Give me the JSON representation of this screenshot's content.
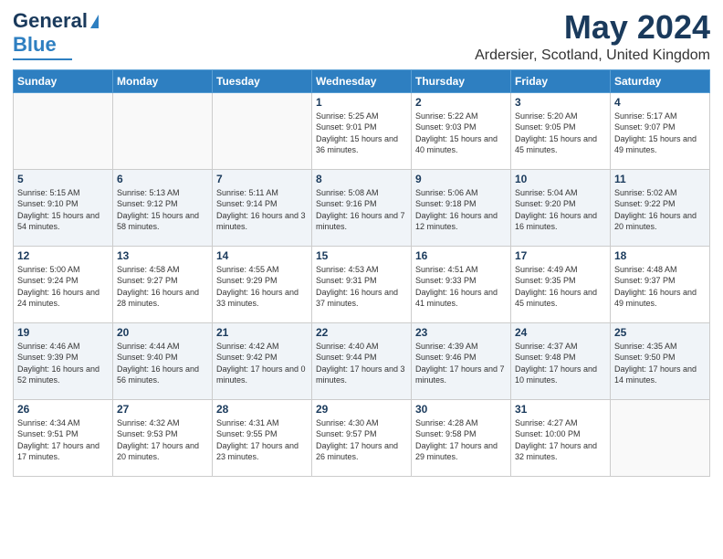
{
  "logo": {
    "line1": "General",
    "line2": "Blue"
  },
  "title": "May 2024",
  "subtitle": "Ardersier, Scotland, United Kingdom",
  "headers": [
    "Sunday",
    "Monday",
    "Tuesday",
    "Wednesday",
    "Thursday",
    "Friday",
    "Saturday"
  ],
  "weeks": [
    [
      {
        "day": "",
        "info": ""
      },
      {
        "day": "",
        "info": ""
      },
      {
        "day": "",
        "info": ""
      },
      {
        "day": "1",
        "info": "Sunrise: 5:25 AM\nSunset: 9:01 PM\nDaylight: 15 hours\nand 36 minutes."
      },
      {
        "day": "2",
        "info": "Sunrise: 5:22 AM\nSunset: 9:03 PM\nDaylight: 15 hours\nand 40 minutes."
      },
      {
        "day": "3",
        "info": "Sunrise: 5:20 AM\nSunset: 9:05 PM\nDaylight: 15 hours\nand 45 minutes."
      },
      {
        "day": "4",
        "info": "Sunrise: 5:17 AM\nSunset: 9:07 PM\nDaylight: 15 hours\nand 49 minutes."
      }
    ],
    [
      {
        "day": "5",
        "info": "Sunrise: 5:15 AM\nSunset: 9:10 PM\nDaylight: 15 hours\nand 54 minutes."
      },
      {
        "day": "6",
        "info": "Sunrise: 5:13 AM\nSunset: 9:12 PM\nDaylight: 15 hours\nand 58 minutes."
      },
      {
        "day": "7",
        "info": "Sunrise: 5:11 AM\nSunset: 9:14 PM\nDaylight: 16 hours\nand 3 minutes."
      },
      {
        "day": "8",
        "info": "Sunrise: 5:08 AM\nSunset: 9:16 PM\nDaylight: 16 hours\nand 7 minutes."
      },
      {
        "day": "9",
        "info": "Sunrise: 5:06 AM\nSunset: 9:18 PM\nDaylight: 16 hours\nand 12 minutes."
      },
      {
        "day": "10",
        "info": "Sunrise: 5:04 AM\nSunset: 9:20 PM\nDaylight: 16 hours\nand 16 minutes."
      },
      {
        "day": "11",
        "info": "Sunrise: 5:02 AM\nSunset: 9:22 PM\nDaylight: 16 hours\nand 20 minutes."
      }
    ],
    [
      {
        "day": "12",
        "info": "Sunrise: 5:00 AM\nSunset: 9:24 PM\nDaylight: 16 hours\nand 24 minutes."
      },
      {
        "day": "13",
        "info": "Sunrise: 4:58 AM\nSunset: 9:27 PM\nDaylight: 16 hours\nand 28 minutes."
      },
      {
        "day": "14",
        "info": "Sunrise: 4:55 AM\nSunset: 9:29 PM\nDaylight: 16 hours\nand 33 minutes."
      },
      {
        "day": "15",
        "info": "Sunrise: 4:53 AM\nSunset: 9:31 PM\nDaylight: 16 hours\nand 37 minutes."
      },
      {
        "day": "16",
        "info": "Sunrise: 4:51 AM\nSunset: 9:33 PM\nDaylight: 16 hours\nand 41 minutes."
      },
      {
        "day": "17",
        "info": "Sunrise: 4:49 AM\nSunset: 9:35 PM\nDaylight: 16 hours\nand 45 minutes."
      },
      {
        "day": "18",
        "info": "Sunrise: 4:48 AM\nSunset: 9:37 PM\nDaylight: 16 hours\nand 49 minutes."
      }
    ],
    [
      {
        "day": "19",
        "info": "Sunrise: 4:46 AM\nSunset: 9:39 PM\nDaylight: 16 hours\nand 52 minutes."
      },
      {
        "day": "20",
        "info": "Sunrise: 4:44 AM\nSunset: 9:40 PM\nDaylight: 16 hours\nand 56 minutes."
      },
      {
        "day": "21",
        "info": "Sunrise: 4:42 AM\nSunset: 9:42 PM\nDaylight: 17 hours\nand 0 minutes."
      },
      {
        "day": "22",
        "info": "Sunrise: 4:40 AM\nSunset: 9:44 PM\nDaylight: 17 hours\nand 3 minutes."
      },
      {
        "day": "23",
        "info": "Sunrise: 4:39 AM\nSunset: 9:46 PM\nDaylight: 17 hours\nand 7 minutes."
      },
      {
        "day": "24",
        "info": "Sunrise: 4:37 AM\nSunset: 9:48 PM\nDaylight: 17 hours\nand 10 minutes."
      },
      {
        "day": "25",
        "info": "Sunrise: 4:35 AM\nSunset: 9:50 PM\nDaylight: 17 hours\nand 14 minutes."
      }
    ],
    [
      {
        "day": "26",
        "info": "Sunrise: 4:34 AM\nSunset: 9:51 PM\nDaylight: 17 hours\nand 17 minutes."
      },
      {
        "day": "27",
        "info": "Sunrise: 4:32 AM\nSunset: 9:53 PM\nDaylight: 17 hours\nand 20 minutes."
      },
      {
        "day": "28",
        "info": "Sunrise: 4:31 AM\nSunset: 9:55 PM\nDaylight: 17 hours\nand 23 minutes."
      },
      {
        "day": "29",
        "info": "Sunrise: 4:30 AM\nSunset: 9:57 PM\nDaylight: 17 hours\nand 26 minutes."
      },
      {
        "day": "30",
        "info": "Sunrise: 4:28 AM\nSunset: 9:58 PM\nDaylight: 17 hours\nand 29 minutes."
      },
      {
        "day": "31",
        "info": "Sunrise: 4:27 AM\nSunset: 10:00 PM\nDaylight: 17 hours\nand 32 minutes."
      },
      {
        "day": "",
        "info": ""
      }
    ]
  ]
}
